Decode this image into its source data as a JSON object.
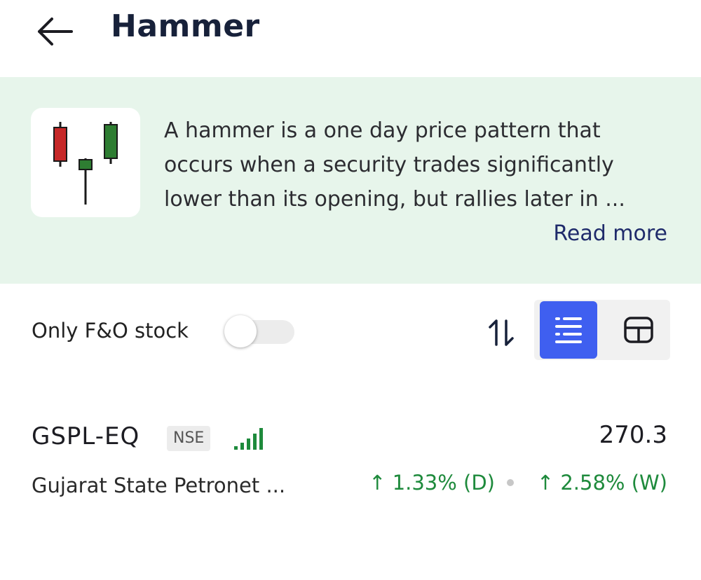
{
  "header": {
    "back_icon": "arrow-left-icon",
    "title": "Hammer"
  },
  "info": {
    "pattern_icon": "candlestick-hammer-icon",
    "description_lines": [
      "A hammer is a one day price pattern that",
      "occurs when a security trades significantly",
      "lower than its opening, but rallies later in ..."
    ],
    "read_more": "Read more",
    "background_color": "#e7f5eb"
  },
  "filters": {
    "fo_label": "Only F&O stock",
    "fo_toggle_on": false,
    "sort_icon": "sort-up-down-icon",
    "view_options": [
      {
        "name": "list",
        "icon": "list-view-icon",
        "active": true
      },
      {
        "name": "grid",
        "icon": "card-view-icon",
        "active": false
      }
    ],
    "active_color": "#3f5ff0"
  },
  "stocks": [
    {
      "symbol": "GSPL-EQ",
      "exchange": "NSE",
      "signal_icon": "signal-strength-icon",
      "price": "270.3",
      "company": "Gujarat State Petronet ...",
      "day_change": "1.33% (D)",
      "week_change": "2.58% (W)",
      "change_color": "#1e8a3c"
    }
  ]
}
